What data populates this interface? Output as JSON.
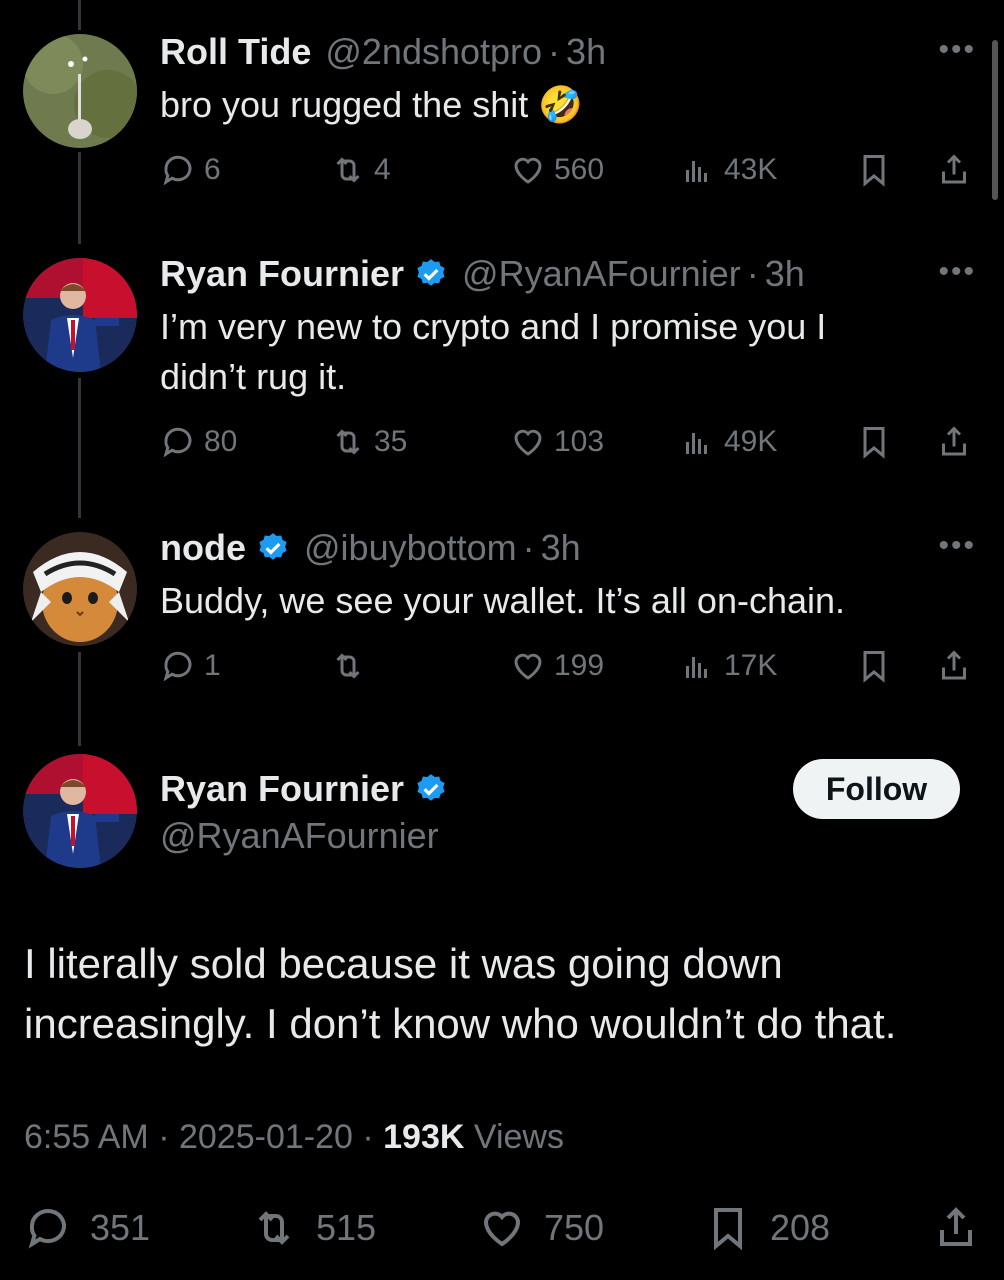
{
  "replies": [
    {
      "name": "Roll Tide",
      "handle": "@2ndshotpro",
      "time": "3h",
      "text": "bro you rugged the shit",
      "emoji": "🤣",
      "verified": false,
      "replies": "6",
      "reposts": "4",
      "likes": "560",
      "views": "43K"
    },
    {
      "name": "Ryan Fournier",
      "handle": "@RyanAFournier",
      "time": "3h",
      "text_line1": "I’m very new to crypto and I promise you I",
      "text_line2": "didn’t rug it.",
      "verified": true,
      "replies": "80",
      "reposts": "35",
      "likes": "103",
      "views": "49K"
    },
    {
      "name": "node",
      "handle": "@ibuybottom",
      "time": "3h",
      "text": "Buddy, we see your wallet. It’s all on-chain.",
      "verified": true,
      "replies": "1",
      "reposts": "",
      "likes": "199",
      "views": "17K"
    }
  ],
  "main": {
    "name": "Ryan Fournier",
    "handle": "@RyanAFournier",
    "follow_label": "Follow",
    "text_line1": "I literally sold because it was going down",
    "text_line2": "increasingly. I don’t know who wouldn’t do that.",
    "time": "6:55 AM",
    "date": "2025-01-20",
    "views_count": "193K",
    "views_label": "Views",
    "replies": "351",
    "reposts": "515",
    "likes": "750",
    "bookmarks": "208"
  },
  "ui": {
    "dot_separator": "·",
    "more_glyph": "•••"
  },
  "colors": {
    "background": "#000000",
    "text": "#e7e9ea",
    "muted": "#71767b",
    "verified": "#1d9bf0"
  }
}
